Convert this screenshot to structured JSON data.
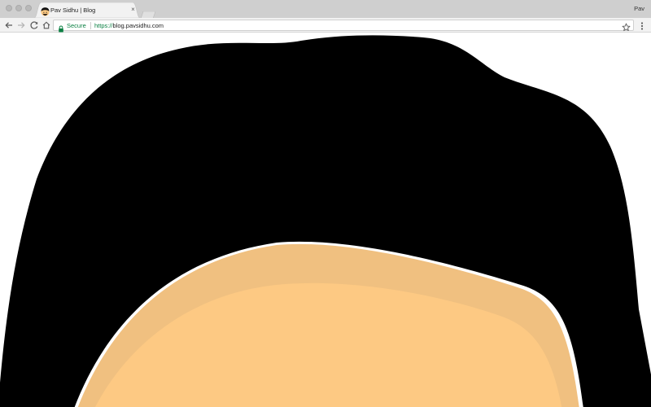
{
  "browser": {
    "tab": {
      "title": "Pav Sidhu | Blog",
      "close_glyph": "×",
      "favicon": "avatar-favicon-icon"
    },
    "profile_name": "Pav",
    "toolbar": {
      "back_icon": "back-arrow-icon",
      "forward_icon": "forward-arrow-icon",
      "reload_icon": "reload-icon",
      "home_icon": "home-icon",
      "bookmark_icon": "star-icon",
      "menu_icon": "kebab-menu-icon"
    },
    "omnibox": {
      "secure_label": "Secure",
      "url_scheme": "https://",
      "url_host": "blog.pavsidhu.com",
      "secure_color": "#0b8043"
    }
  },
  "page": {
    "illustration": "cartoon-avatar-hair-and-forehead",
    "colors": {
      "hair": "#000000",
      "skin_outer": "#f0c080",
      "skin_inner": "#fdc983",
      "highlight": "#ffffff",
      "background": "#ffffff"
    }
  }
}
